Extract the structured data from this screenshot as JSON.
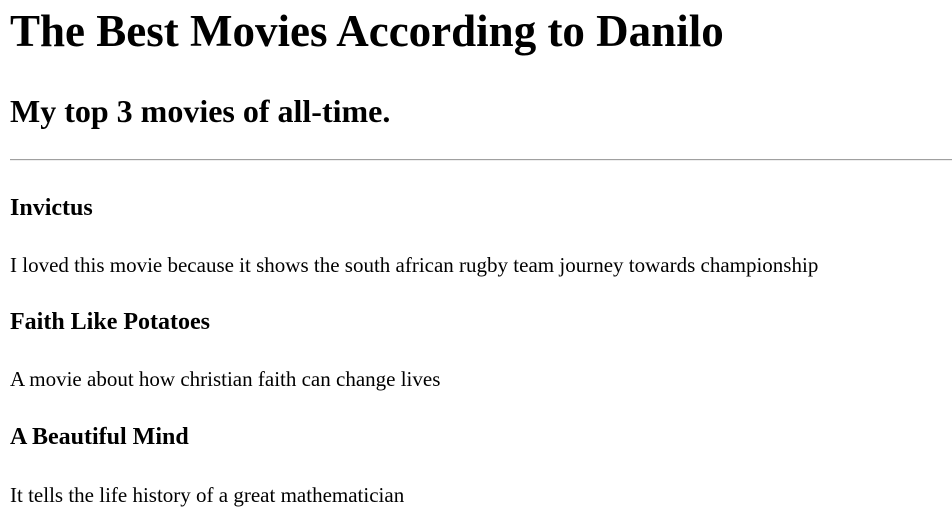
{
  "page": {
    "title": "The Best Movies According to Danilo",
    "subtitle": "My top 3 movies of all-time."
  },
  "movies": [
    {
      "title": "Invictus",
      "description": "I loved this movie because it shows the south african rugby team journey towards championship"
    },
    {
      "title": "Faith Like Potatoes",
      "description": "A movie about how christian faith can change lives"
    },
    {
      "title": "A Beautiful Mind",
      "description": "It tells the life history of a great mathematician"
    }
  ]
}
